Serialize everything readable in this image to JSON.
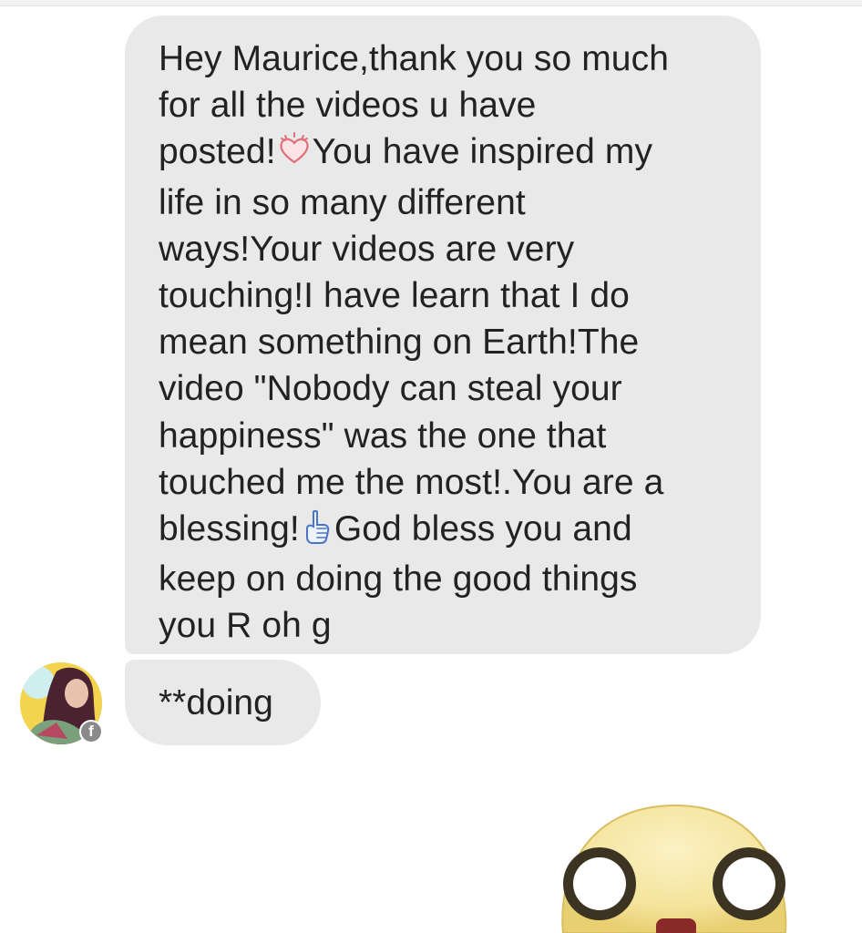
{
  "conversation": {
    "message_1": {
      "lines": [
        "Hey Maurice,thank you so much",
        "for all the videos u have",
        "posted!",
        "You have inspired my",
        "life in so many different",
        "ways!Your videos are very",
        "touching!I have learn that I do",
        "mean something on Earth!The",
        "video \"Nobody can steal your",
        "happiness\" was the one that",
        "touched me the most!.You are a",
        "blessing!",
        "God bless you and",
        "keep on doing the good things",
        "you R oh g"
      ],
      "emojis": [
        "heart-emoji",
        "pointing-up-emoji"
      ]
    },
    "message_2": {
      "text": "**doing"
    },
    "sender": {
      "avatar": "profile-photo",
      "badge_icon": "facebook-icon",
      "badge_letter": "f"
    },
    "sticker": {
      "name": "wide-eyed-face-sticker"
    }
  },
  "colors": {
    "bubble": "#e9e9e9",
    "text": "#222222",
    "background": "#ffffff",
    "badge": "#8a8a8a",
    "sticker_face": "#f6e9a6"
  }
}
